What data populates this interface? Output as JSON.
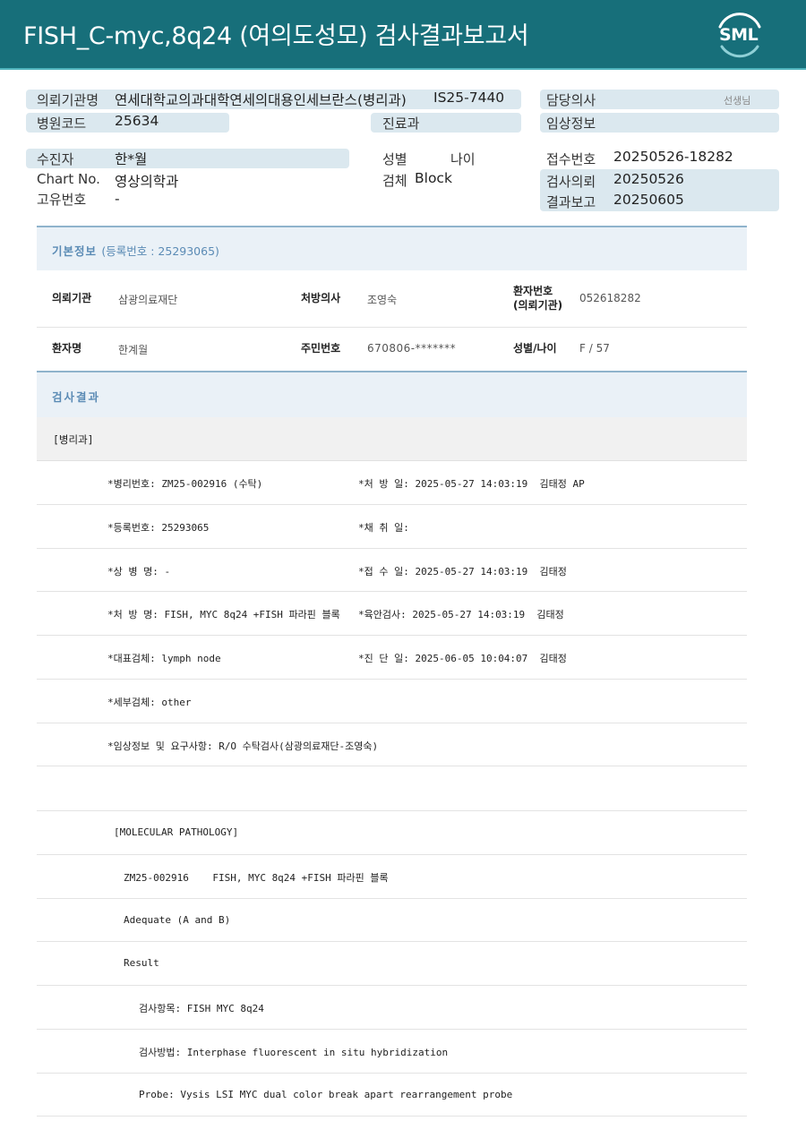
{
  "header": {
    "title": "FISH_C-myc,8q24 (여의도성모) 검사결과보고서",
    "logo_text": "SML"
  },
  "meta": {
    "requesting_institution_label": "의뢰기관명",
    "requesting_institution_value": "연세대학교의과대학연세의대용인세브란스(병리과)",
    "reference_code": "IS25-7440",
    "attending_doctor_label": "담당의사",
    "attending_doctor_suffix": "선생님",
    "hospital_code_label": "병원코드",
    "hospital_code_value": "25634",
    "department_label": "진료과",
    "clinical_info_label": "임상정보",
    "patient_label": "수진자",
    "patient_value": "한*월",
    "sex_label": "성별",
    "age_label": "나이",
    "receipt_no_label": "접수번호",
    "receipt_no_value": "20250526-18282",
    "chart_no_label": "Chart No.",
    "chart_no_value": "영상의학과",
    "specimen_label": "검체",
    "specimen_value": "Block",
    "request_date_label": "검사의뢰",
    "request_date_value": "20250526",
    "unique_no_label": "고유번호",
    "unique_no_value": "-",
    "report_date_label": "결과보고",
    "report_date_value": "20250605"
  },
  "basic_info": {
    "title": "기본정보",
    "registration": "(등록번호 : 25293065)",
    "institution_label": "의뢰기관",
    "institution_value": "삼광의료재단",
    "doctor_label": "처방의사",
    "doctor_value": "조영숙",
    "patient_no_label_1": "환자번호",
    "patient_no_label_2": "(의뢰기관)",
    "patient_no_value": "052618282",
    "patient_name_label": "환자명",
    "patient_name_value": "한계월",
    "rrn_label": "주민번호",
    "rrn_value": "670806-*******",
    "sex_age_label": "성별/나이",
    "sex_age_value": "F / 57"
  },
  "results": {
    "title": "검사결과",
    "section_tag": "[병리과]",
    "rows": [
      {
        "left": "*병리번호: ZM25-002916 (수탁)",
        "right": "*처 방 일: 2025-05-27 14:03:19  김태정 AP"
      },
      {
        "left": "*등록번호: 25293065",
        "right": "*채 취 일:"
      },
      {
        "left": "*상 병 명: -",
        "right": "*접 수 일: 2025-05-27 14:03:19  김태정"
      },
      {
        "left": "*처 방 명: FISH, MYC 8q24 +FISH 파라핀 블록",
        "right": "*육안검사: 2025-05-27 14:03:19  김태정"
      },
      {
        "left": "*대표검체: lymph node",
        "right": "*진 단 일: 2025-06-05 10:04:07  김태정"
      },
      {
        "left": "*세부검체: other",
        "right": ""
      },
      {
        "left": "*임상정보 및 요구사항: R/O 수탁검사(삼광의료재단-조영숙)",
        "right": ""
      }
    ],
    "molecular": [
      "[MOLECULAR PATHOLOGY]",
      "ZM25-002916    FISH, MYC 8q24 +FISH 파라핀 블록",
      "Adequate (A and B)",
      "Result",
      "검사항목: FISH MYC 8q24",
      "검사방법: Interphase fluorescent in situ hybridization",
      "Probe: Vysis LSI MYC dual color break apart rearrangement probe"
    ]
  }
}
